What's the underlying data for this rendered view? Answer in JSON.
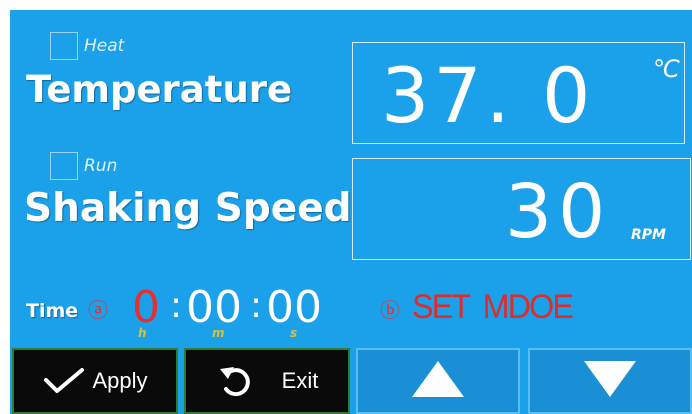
{
  "temperature": {
    "checkbox_label": "Heat",
    "label": "Temperature",
    "value": "37. 0",
    "unit": "℃"
  },
  "shaking": {
    "checkbox_label": "Run",
    "label": "Shaking Speed",
    "value": "30",
    "unit": "RPM"
  },
  "time": {
    "label": "Time",
    "marker": "ⓐ",
    "hours": "0",
    "minutes": "00",
    "seconds": "00",
    "separator": ":",
    "hours_unit": "h",
    "minutes_unit": "m",
    "seconds_unit": "s"
  },
  "mode": {
    "marker": "ⓑ",
    "text": "SET  MDOE"
  },
  "buttons": {
    "apply": "Apply",
    "exit": "Exit"
  },
  "colors": {
    "background": "#1ba1ea",
    "mode_text": "#e02b2b",
    "hours_digit": "#e53030",
    "time_units": "#d8c03a"
  },
  "icons": {
    "apply": "checkmark-icon",
    "exit": "rotate-back-icon",
    "up": "up-arrow-icon",
    "down": "down-arrow-icon"
  }
}
